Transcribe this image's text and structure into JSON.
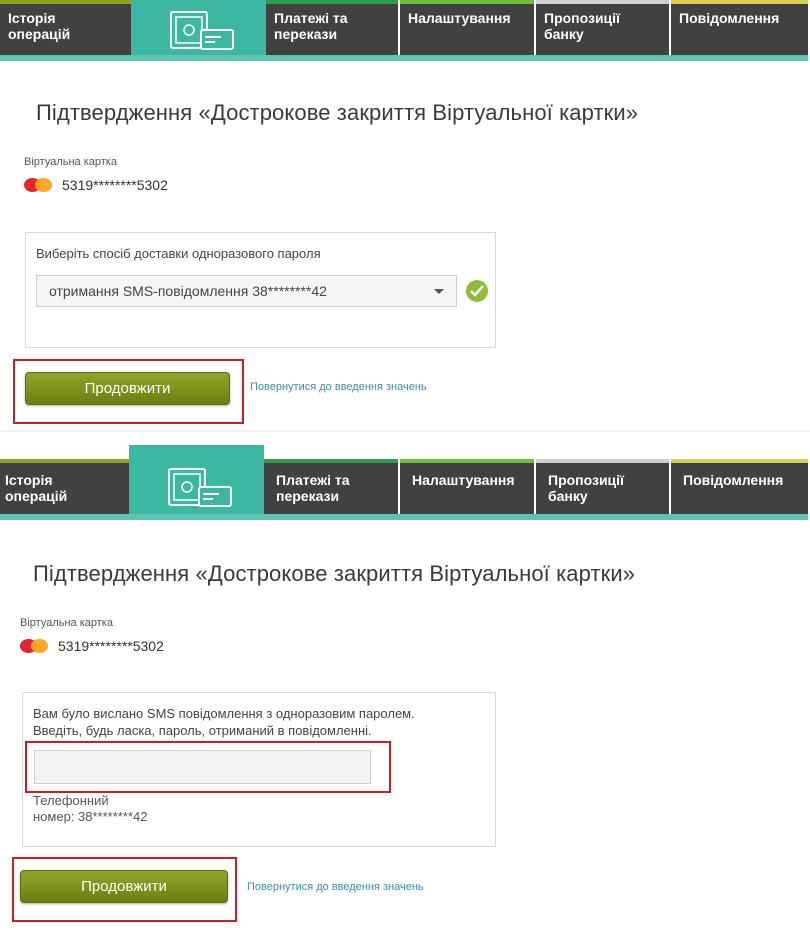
{
  "nav": {
    "items": [
      {
        "label": "Історія\nоперацій"
      },
      {
        "label": "Платежі та\nперекази"
      },
      {
        "label": "Налаштування"
      },
      {
        "label": "Пропозиції\nбанку"
      },
      {
        "label": "Повідомлення"
      }
    ],
    "icon": "safe-and-card-icon"
  },
  "colors": {
    "nav_bg": "#414141",
    "nav_active": "#3bb7a2",
    "button_green": "#7b8f1b",
    "highlight_red": "#c62027",
    "link_blue": "#3a8fa8",
    "check_green": "#8fbd3a"
  },
  "screens": [
    {
      "title": "Підтвердження «Дострокове закриття Віртуальної картки»",
      "card_label": "Віртуальна картка",
      "card_number": "5319********5302",
      "delivery_label": "Виберіть спосіб доставки одноразового пароля",
      "delivery_selected": "отримання SMS-повідомлення 38********42",
      "continue_label": "Продовжити",
      "back_link": "Повернутися до введення значень"
    },
    {
      "title": "Підтвердження «Дострокове закриття Віртуальної картки»",
      "card_label": "Віртуальна картка",
      "card_number": "5319********5302",
      "sms_message_1": "Вам було вислано SMS повідомлення з одноразовим паролем.",
      "sms_message_2": "Введіть, будь ласка, пароль, отриманий в повідомленні.",
      "password_value": "",
      "phone_label": "Телефонний\nномер: 38********42",
      "continue_label": "Продовжити",
      "back_link": "Повернутися до введення значень"
    }
  ]
}
